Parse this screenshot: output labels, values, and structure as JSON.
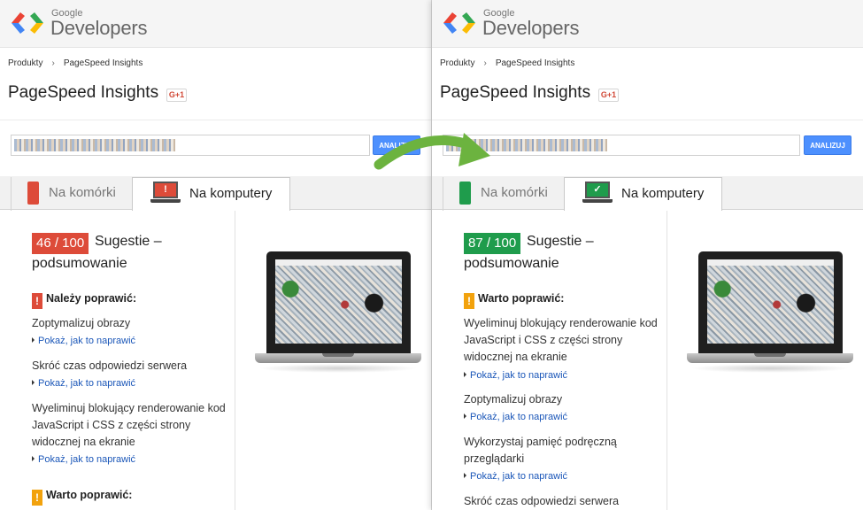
{
  "colors": {
    "red": "#dd4b39",
    "green": "#1f9c4c",
    "orange": "#f2a20d",
    "link": "#1a56b8",
    "button": "#4d90fe",
    "arrow": "#6cb33f"
  },
  "header": {
    "logo_small": "Google",
    "logo_big": "Developers"
  },
  "breadcrumb": {
    "items": [
      "Produkty",
      "PageSpeed Insights"
    ]
  },
  "page": {
    "title": "PageSpeed Insights",
    "gplus_label": "G+1"
  },
  "url_bar": {
    "button_label": "ANALIZUJ"
  },
  "tabs": {
    "mobile": "Na komórki",
    "desktop": "Na komputery"
  },
  "left": {
    "score": "46 / 100",
    "score_label_1": "Sugestie –",
    "score_label_2": "podsumowanie",
    "section_must_fix": "Należy poprawić:",
    "rules": [
      "Zoptymalizuj obrazy",
      "Skróć czas odpowiedzi serwera",
      "Wyeliminuj blokujący renderowanie kod JavaScript i CSS z części strony widocznej na ekranie"
    ],
    "link_label": "Pokaż, jak to naprawić",
    "section_consider_fix": "Warto poprawić:"
  },
  "right": {
    "score": "87 / 100",
    "score_label_1": "Sugestie –",
    "score_label_2": "podsumowanie",
    "section_consider_fix": "Warto poprawić:",
    "rules": [
      "Wyeliminuj blokujący renderowanie kod JavaScript i CSS z części strony widocznej na ekranie",
      "Zoptymalizuj obrazy",
      "Wykorzystaj pamięć podręczną przeglądarki",
      "Skróć czas odpowiedzi serwera"
    ],
    "link_label": "Pokaż, jak to naprawić"
  },
  "icons": {
    "logo": "google-developers-logo-icon",
    "phone": "phone-icon",
    "monitor": "monitor-icon",
    "warning": "exclamation-icon",
    "check": "check-icon",
    "arrow": "curved-arrow-icon"
  }
}
